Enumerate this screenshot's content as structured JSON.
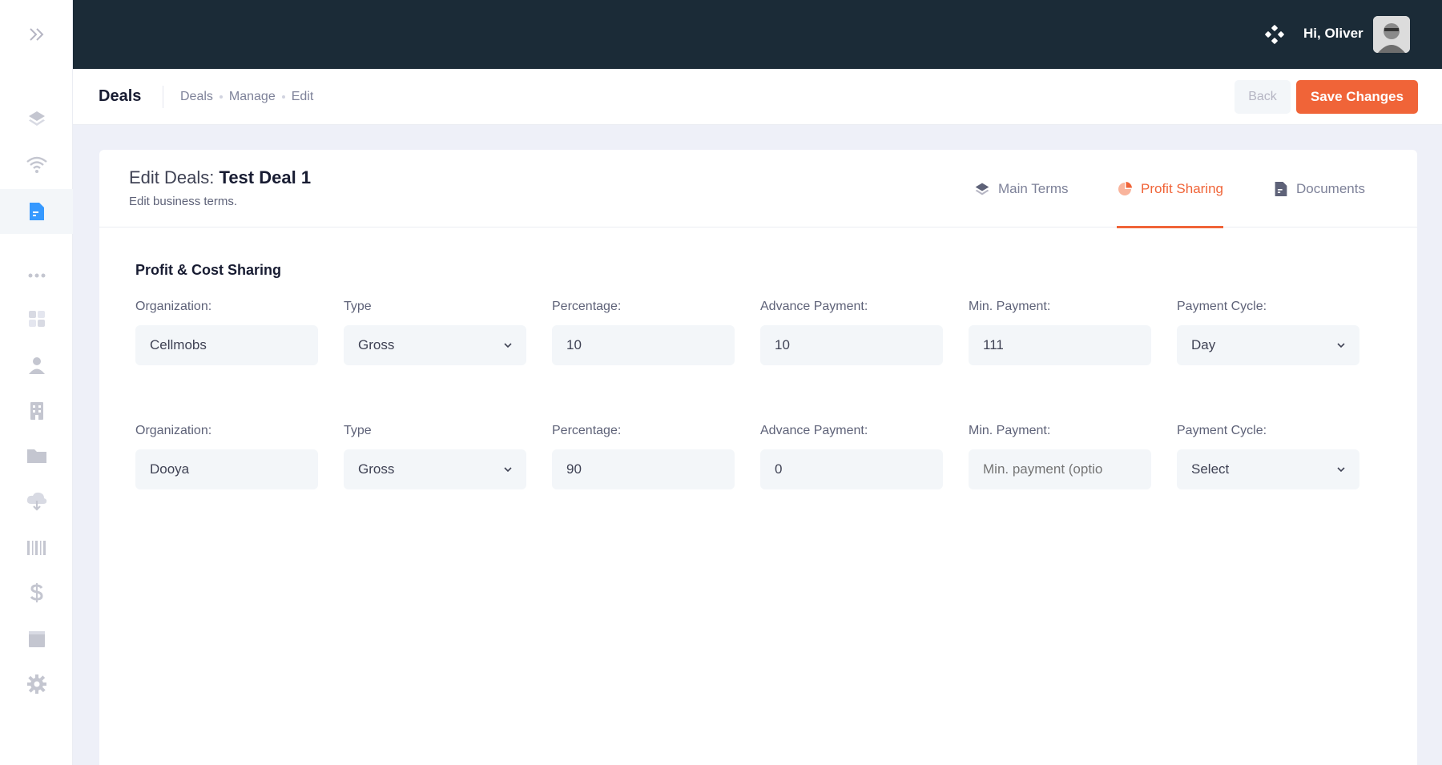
{
  "header": {
    "greeting": "Hi, Oliver",
    "icons": [
      "toggle-icon",
      "apps-icon",
      "avatar"
    ]
  },
  "subheader": {
    "title": "Deals",
    "breadcrumbs": [
      "Deals",
      "Manage",
      "Edit"
    ],
    "back_label": "Back",
    "save_label": "Save Changes"
  },
  "sidebar": {
    "items": [
      {
        "icon": "layers-icon"
      },
      {
        "icon": "wifi-icon"
      },
      {
        "icon": "document-icon",
        "active": true
      },
      {
        "icon": "more-icon"
      },
      {
        "icon": "dashboard-icon"
      },
      {
        "icon": "user-icon"
      },
      {
        "icon": "building-icon"
      },
      {
        "icon": "folder-icon"
      },
      {
        "icon": "cloud-download-icon"
      },
      {
        "icon": "barcode-icon"
      },
      {
        "icon": "dollar-icon"
      },
      {
        "icon": "book-icon"
      },
      {
        "icon": "settings-icon"
      }
    ]
  },
  "card": {
    "title_prefix": "Edit Deals:",
    "title_name": "Test Deal 1",
    "subtitle": "Edit business terms.",
    "tabs": [
      {
        "label": "Main Terms",
        "icon": "layers-icon"
      },
      {
        "label": "Profit Sharing",
        "icon": "pie-chart-icon",
        "active": true
      },
      {
        "label": "Documents",
        "icon": "document-icon"
      }
    ]
  },
  "section": {
    "title": "Profit & Cost Sharing",
    "labels": {
      "organization": "Organization:",
      "type": "Type",
      "percentage": "Percentage:",
      "advance_payment": "Advance Payment:",
      "min_payment": "Min. Payment:",
      "payment_cycle": "Payment Cycle:"
    },
    "rows": [
      {
        "organization": "Cellmobs",
        "type": "Gross",
        "percentage": "10",
        "advance_payment": "10",
        "min_payment": "111",
        "min_payment_placeholder": "",
        "payment_cycle": "Day"
      },
      {
        "organization": "Dooya",
        "type": "Gross",
        "percentage": "90",
        "advance_payment": "0",
        "min_payment": "",
        "min_payment_placeholder": "Min. payment (optio",
        "payment_cycle": "Select"
      }
    ]
  },
  "colors": {
    "accent": "#f06438",
    "topbar": "#1b2b37",
    "sidebar_active": "#3699ff"
  }
}
